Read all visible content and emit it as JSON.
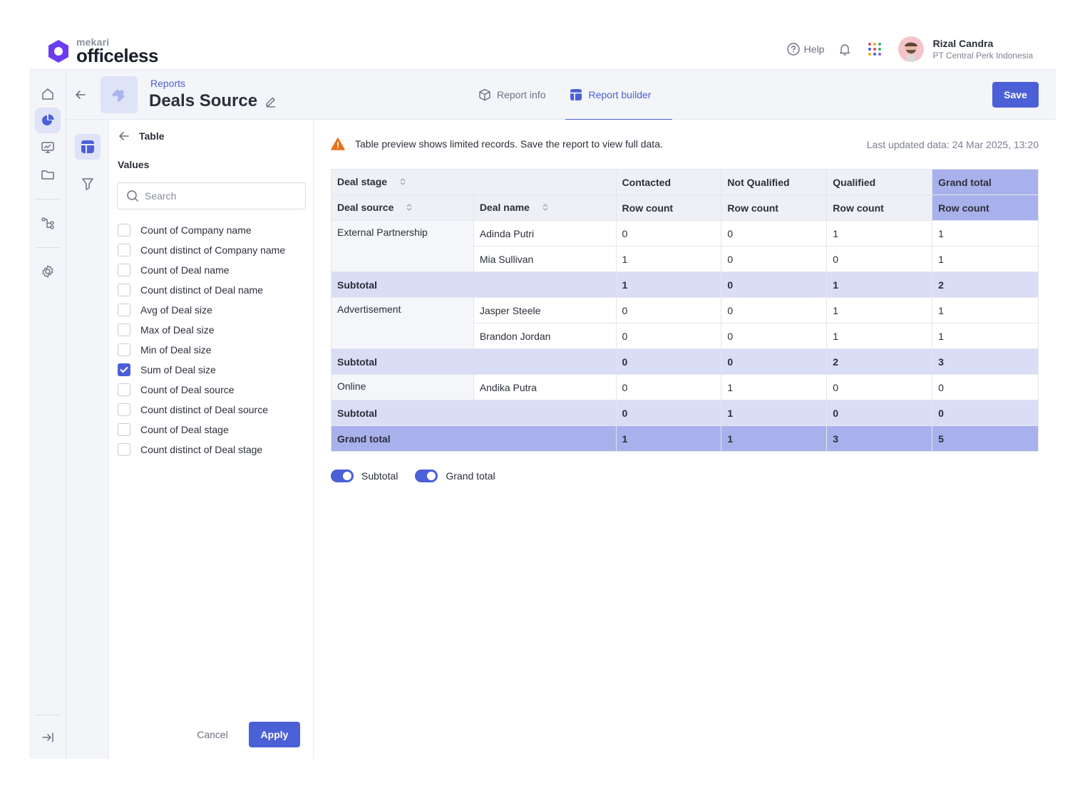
{
  "brand": {
    "small": "mekari",
    "big": "officeless"
  },
  "header": {
    "help_label": "Help",
    "user_name": "Rizal Candra",
    "user_org": "PT Central Perk Indonesia",
    "app_dot_colors": [
      "#e94560",
      "#f0a81b",
      "#2fb36b",
      "#4b5fd6",
      "#e94560",
      "#2fb36b",
      "#f0a81b",
      "#4b5fd6",
      "#8b5cf6"
    ]
  },
  "page": {
    "breadcrumb": "Reports",
    "title": "Deals Source",
    "tabs": [
      {
        "label": "Report info",
        "icon": "box-icon"
      },
      {
        "label": "Report builder",
        "icon": "table-icon"
      }
    ],
    "save_label": "Save"
  },
  "values_panel": {
    "back_label": "Table",
    "section_label": "Values",
    "search_placeholder": "Search",
    "options": [
      {
        "label": "Count of Company name",
        "checked": false
      },
      {
        "label": "Count distinct of Company name",
        "checked": false
      },
      {
        "label": "Count of Deal name",
        "checked": false
      },
      {
        "label": "Count distinct of Deal name",
        "checked": false
      },
      {
        "label": "Avg of Deal size",
        "checked": false
      },
      {
        "label": "Max of Deal size",
        "checked": false
      },
      {
        "label": "Min of Deal size",
        "checked": false
      },
      {
        "label": "Sum of Deal size",
        "checked": true
      },
      {
        "label": "Count of Deal source",
        "checked": false
      },
      {
        "label": "Count distinct of Deal source",
        "checked": false
      },
      {
        "label": "Count of Deal stage",
        "checked": false
      },
      {
        "label": "Count distinct of Deal stage",
        "checked": false
      }
    ],
    "cancel_label": "Cancel",
    "apply_label": "Apply"
  },
  "preview": {
    "notice": "Table preview shows limited records. Save the report to view full data.",
    "updated": "Last updated data: 24 Mar 2025, 13:20",
    "header": {
      "deal_stage": "Deal stage",
      "deal_source": "Deal source",
      "deal_name": "Deal name",
      "columns": [
        "Contacted",
        "Not Qualified",
        "Qualified",
        "Grand total"
      ],
      "measure": "Row count"
    },
    "groups": [
      {
        "source": "External Partnership",
        "rows": [
          {
            "name": "Adinda Putri",
            "values": [
              "0",
              "0",
              "1",
              "1"
            ]
          },
          {
            "name": "Mia Sullivan",
            "values": [
              "1",
              "0",
              "0",
              "1"
            ]
          }
        ],
        "subtotal": [
          "1",
          "0",
          "1",
          "2"
        ]
      },
      {
        "source": "Advertisement",
        "rows": [
          {
            "name": "Jasper Steele",
            "values": [
              "0",
              "0",
              "1",
              "1"
            ]
          },
          {
            "name": "Brandon Jordan",
            "values": [
              "0",
              "0",
              "1",
              "1"
            ]
          }
        ],
        "subtotal": [
          "0",
          "0",
          "2",
          "3"
        ]
      },
      {
        "source": "Online",
        "rows": [
          {
            "name": "Andika Putra",
            "values": [
              "0",
              "1",
              "0",
              "0"
            ]
          }
        ],
        "subtotal": [
          "0",
          "1",
          "0",
          "0"
        ]
      }
    ],
    "subtotal_label": "Subtotal",
    "grand_total_label": "Grand total",
    "grand_total": [
      "1",
      "1",
      "3",
      "5"
    ],
    "toggles": [
      {
        "label": "Subtotal",
        "on": true
      },
      {
        "label": "Grand total",
        "on": true
      }
    ]
  }
}
